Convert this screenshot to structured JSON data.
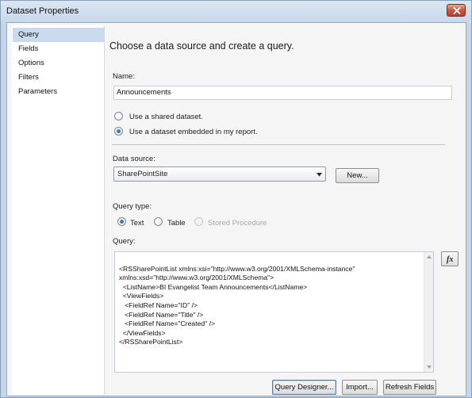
{
  "window": {
    "title": "Dataset Properties",
    "close_label": "✕"
  },
  "nav": {
    "items": [
      {
        "label": "Query",
        "selected": true
      },
      {
        "label": "Fields",
        "selected": false
      },
      {
        "label": "Options",
        "selected": false
      },
      {
        "label": "Filters",
        "selected": false
      },
      {
        "label": "Parameters",
        "selected": false
      }
    ]
  },
  "main": {
    "heading": "Choose a data source and create a query.",
    "name_label": "Name:",
    "name_value": "Announcements",
    "radio_shared": {
      "label": "Use a shared dataset.",
      "checked": false
    },
    "radio_embedded": {
      "label": "Use a dataset embedded in my report.",
      "checked": true
    },
    "datasource_label": "Data source:",
    "datasource_value": "SharePointSite",
    "new_button": "New...",
    "query_type_label": "Query type:",
    "query_types": [
      {
        "label": "Text",
        "checked": true,
        "enabled": true
      },
      {
        "label": "Table",
        "checked": false,
        "enabled": true
      },
      {
        "label": "Stored Procedure",
        "checked": false,
        "enabled": false
      }
    ],
    "query_label": "Query:",
    "query_lines": [
      "<RSSharePointList xmlns:xsi=\"http://www.w3.org/2001/XMLSchema-instance\"",
      "xmlns:xsd=\"http://www.w3.org/2001/XMLSchema\">",
      "  <ListName>BI Evangelist Team Announcements</ListName>",
      "  <ViewFields>",
      "   <FieldRef Name=\"ID\" />",
      "   <FieldRef Name=\"Title\" />",
      "   <FieldRef Name=\"Created\" />",
      "  </ViewFields>",
      "</RSSharePointList>"
    ],
    "fx_label": "fx",
    "buttons": {
      "query_designer": "Query Designer...",
      "import": "Import...",
      "refresh_fields": "Refresh Fields"
    }
  }
}
